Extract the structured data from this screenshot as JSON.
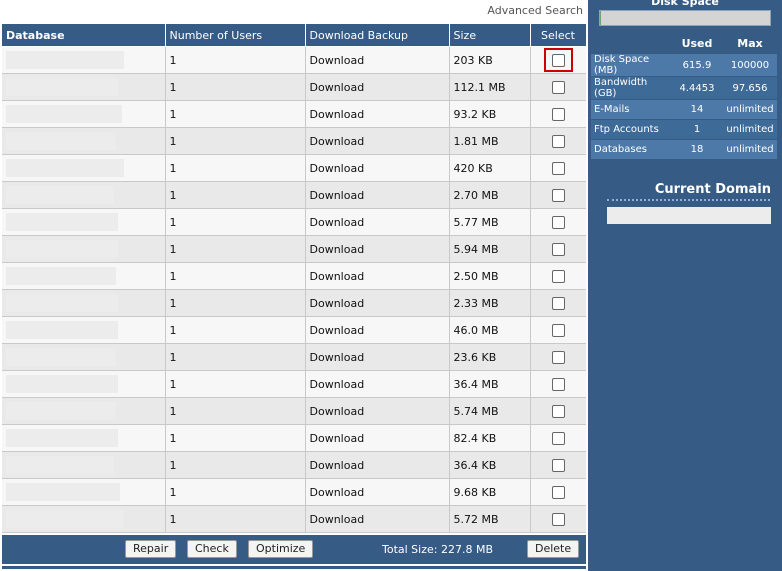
{
  "main": {
    "advanced_search": "Advanced Search",
    "columns": {
      "database": "Database",
      "users": "Number of Users",
      "backup": "Download Backup",
      "size": "Size",
      "select": "Select"
    },
    "rows": [
      {
        "users": "1",
        "backup": "Download",
        "size": "203 KB"
      },
      {
        "users": "1",
        "backup": "Download",
        "size": "112.1 MB"
      },
      {
        "users": "1",
        "backup": "Download",
        "size": "93.2 KB"
      },
      {
        "users": "1",
        "backup": "Download",
        "size": "1.81 MB"
      },
      {
        "users": "1",
        "backup": "Download",
        "size": "420 KB"
      },
      {
        "users": "1",
        "backup": "Download",
        "size": "2.70 MB"
      },
      {
        "users": "1",
        "backup": "Download",
        "size": "5.77 MB"
      },
      {
        "users": "1",
        "backup": "Download",
        "size": "5.94 MB"
      },
      {
        "users": "1",
        "backup": "Download",
        "size": "2.50 MB"
      },
      {
        "users": "1",
        "backup": "Download",
        "size": "2.33 MB"
      },
      {
        "users": "1",
        "backup": "Download",
        "size": "46.0 MB"
      },
      {
        "users": "1",
        "backup": "Download",
        "size": "23.6 KB"
      },
      {
        "users": "1",
        "backup": "Download",
        "size": "36.4 MB"
      },
      {
        "users": "1",
        "backup": "Download",
        "size": "5.74 MB"
      },
      {
        "users": "1",
        "backup": "Download",
        "size": "82.4 KB"
      },
      {
        "users": "1",
        "backup": "Download",
        "size": "36.4 KB"
      },
      {
        "users": "1",
        "backup": "Download",
        "size": "9.68 KB"
      },
      {
        "users": "1",
        "backup": "Download",
        "size": "5.72 MB"
      }
    ],
    "footer": {
      "repair": "Repair",
      "check": "Check",
      "optimize": "Optimize",
      "total_size": "Total Size: 227.8 MB",
      "delete": "Delete"
    }
  },
  "sidebar": {
    "disk_space_title": "Disk Space",
    "disk_usage_fraction": 0.006,
    "stats_header": {
      "used": "Used",
      "max": "Max"
    },
    "stats": [
      {
        "label": "Disk Space (MB)",
        "used": "615.9",
        "max": "100000"
      },
      {
        "label": "Bandwidth (GB)",
        "used": "4.4453",
        "max": "97.656"
      },
      {
        "label": "E-Mails",
        "used": "14",
        "max": "unlimited"
      },
      {
        "label": "Ftp Accounts",
        "used": "1",
        "max": "unlimited"
      },
      {
        "label": "Databases",
        "used": "18",
        "max": "unlimited"
      }
    ],
    "current_domain_title": "Current Domain"
  },
  "colors": {
    "header_blue": "#365b85",
    "highlight_red": "#cc0000"
  }
}
